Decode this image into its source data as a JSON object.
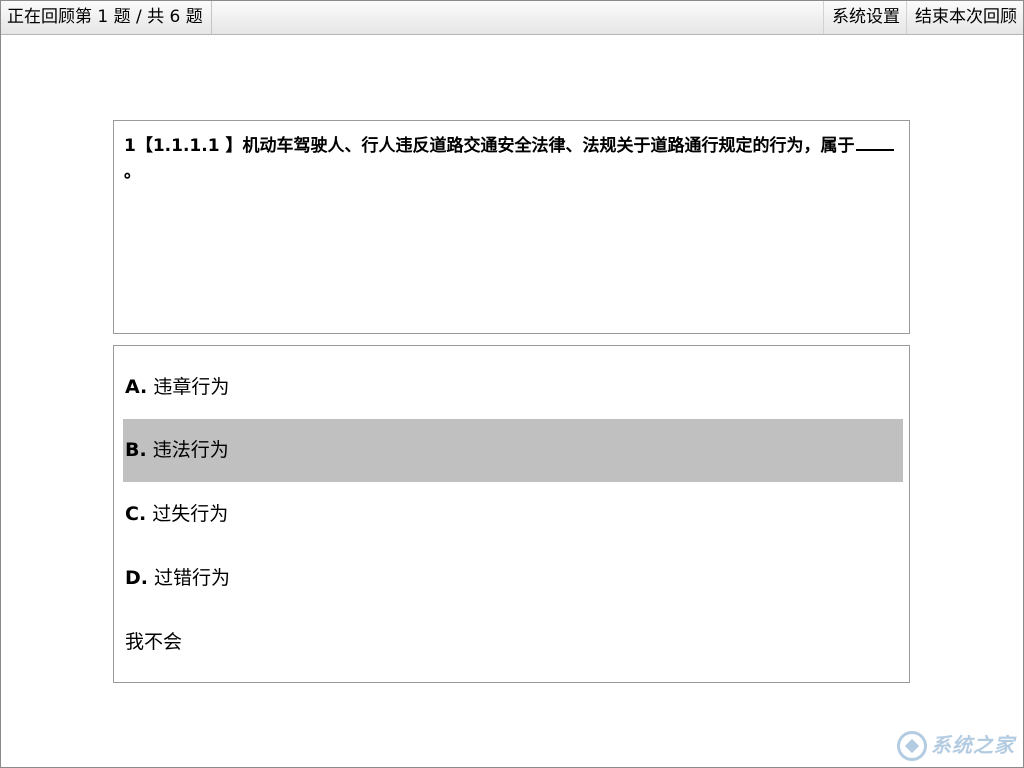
{
  "header": {
    "status_text": "正在回顾第 1 题 / 共 6 题",
    "settings_label": "系统设置",
    "end_review_label": "结束本次回顾"
  },
  "question": {
    "number": "1",
    "code": "【1.1.1.1 】",
    "text_before_blank": "机动车驾驶人、行人违反道路交通安全法律、法规关于道路通行规定的行为，属于",
    "text_after_blank": "。"
  },
  "options": [
    {
      "letter": "A.",
      "text": "违章行为",
      "selected": false
    },
    {
      "letter": "B.",
      "text": "违法行为",
      "selected": true
    },
    {
      "letter": "C.",
      "text": "过失行为",
      "selected": false
    },
    {
      "letter": "D.",
      "text": "过错行为",
      "selected": false
    }
  ],
  "dont_know": {
    "text": "我不会"
  },
  "watermark": {
    "text": "系统之家",
    "icon": "site-logo-icon"
  },
  "colors": {
    "selected_option_bg": "#c0c0c0",
    "border": "#9a9a9a"
  }
}
